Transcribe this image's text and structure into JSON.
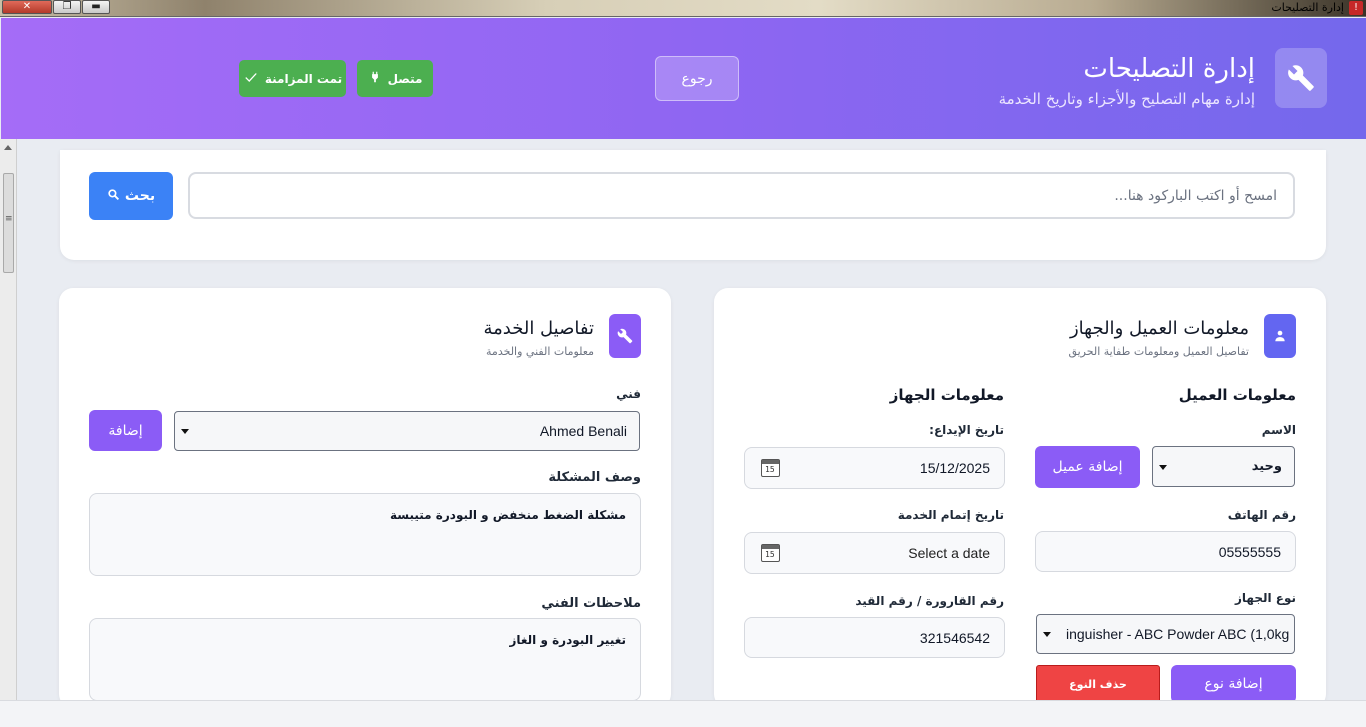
{
  "window": {
    "title": "إدارة التصليحات",
    "buttons": {
      "close": "✕",
      "restore": "❐",
      "minimize": "▬"
    }
  },
  "header": {
    "title": "إدارة التصليحات",
    "subtitle": "إدارة مهام التصليح والأجزاء وتاريخ الخدمة",
    "icon": "wrench-icon",
    "back_label": "رجوع",
    "connected_label": "متصل",
    "synced_label": "تمت المزامنة",
    "status_color": "#4caf50"
  },
  "search": {
    "placeholder": "امسح أو اكتب الباركود هنا...",
    "button_label": "بحث",
    "button_color": "#3b82f6"
  },
  "customer_card": {
    "title": "معلومات العميل والجهاز",
    "subtitle": "تفاصيل العميل ومعلومات طفاية الحريق",
    "icon": "user-icon",
    "icon_color": "#6366f1",
    "customer_col": {
      "heading": "معلومات العميل",
      "name_label": "الاسم",
      "name_value": "وحيد",
      "add_customer_label": "إضافة عميل",
      "phone_label": "رقم الهاتف",
      "phone_value": "05555555",
      "device_type_label": "نوع الجهاز",
      "device_type_value": "inguisher - ABC Powder ABC (1,0kg",
      "add_type_label": "إضافة نوع",
      "delete_type_label": "حذف النوع"
    },
    "device_col": {
      "heading": "معلومات الجهاز",
      "deposit_date_label": "تاريخ الإيداع:",
      "deposit_date_value": "15/12/2025",
      "completion_date_label": "تاريخ إتمام الخدمة",
      "completion_date_value": "Select a date",
      "bottle_number_label": "رقم القارورة / رقم القيد",
      "bottle_number_value": "321546542",
      "calendar_glyph": "15"
    }
  },
  "service_card": {
    "title": "تفاصيل الخدمة",
    "subtitle": "معلومات الفني والخدمة",
    "icon": "wrench-icon",
    "icon_color": "#8b5cf6",
    "technician_label": "فني",
    "technician_value": "Ahmed Benali",
    "add_label": "إضافة",
    "problem_label": "وصف المشكلة",
    "problem_value": "مشكلة الضغط منخفض و البودرة متيبسة",
    "notes_label": "ملاحظات الفني",
    "notes_value": "تغيير البودرة و الغاز"
  }
}
